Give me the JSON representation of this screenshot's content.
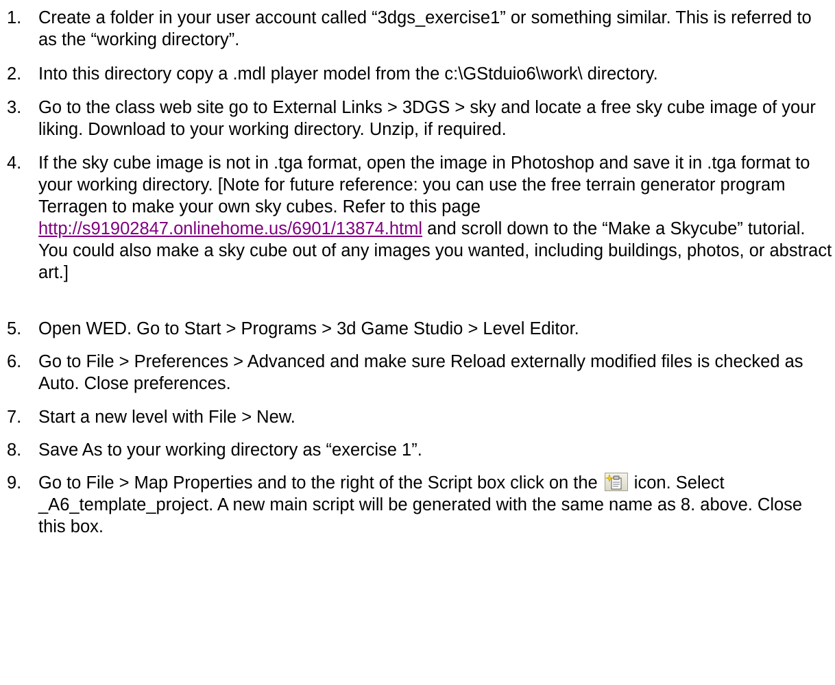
{
  "steps": [
    {
      "number": "1.",
      "text": "Create a folder in your user account called “3dgs_exercise1” or something similar. This is referred to as the “working directory”."
    },
    {
      "number": "2.",
      "text": "Into this directory copy a .mdl player model from the c:\\GStduio6\\work\\ directory."
    },
    {
      "number": "3.",
      "text": "Go to the class web site go to External Links > 3DGS > sky and locate a free sky cube image of your liking. Download to your working directory. Unzip, if required."
    },
    {
      "number": "4.",
      "text_before_link": "If the sky cube image is not in .tga format, open the image in Photoshop and save it in .tga format to your working directory. [Note for future reference: you can use the free terrain generator program Terragen to make your own sky cubes. Refer to this page ",
      "link": "http://s91902847.onlinehome.us/6901/13874.html",
      "text_after_link": " and scroll down to the “Make a Skycube” tutorial. You could also make a sky cube out of any images you wanted, including buildings, photos, or abstract art.]"
    },
    {
      "number": "5.",
      "text": "Open WED. Go to Start > Programs > 3d Game Studio > Level Editor."
    },
    {
      "number": "6.",
      "text": "Go to File > Preferences > Advanced and make sure Reload externally modified files is checked as Auto. Close preferences."
    },
    {
      "number": "7.",
      "text": "Start a new level with File > New."
    },
    {
      "number": "8.",
      "text": "Save As to your working directory as “exercise 1”."
    },
    {
      "number": "9.",
      "text_before_icon": "Go to File > Map Properties and to the right of the Script box click on the",
      "icon": "new-script-icon",
      "text_after_icon": " icon. Select _A6_template_project. A new main script will be generated with the same name as 8. above. Close this box."
    }
  ],
  "colors": {
    "text": "#000000",
    "link": "#800080",
    "background": "#ffffff"
  }
}
